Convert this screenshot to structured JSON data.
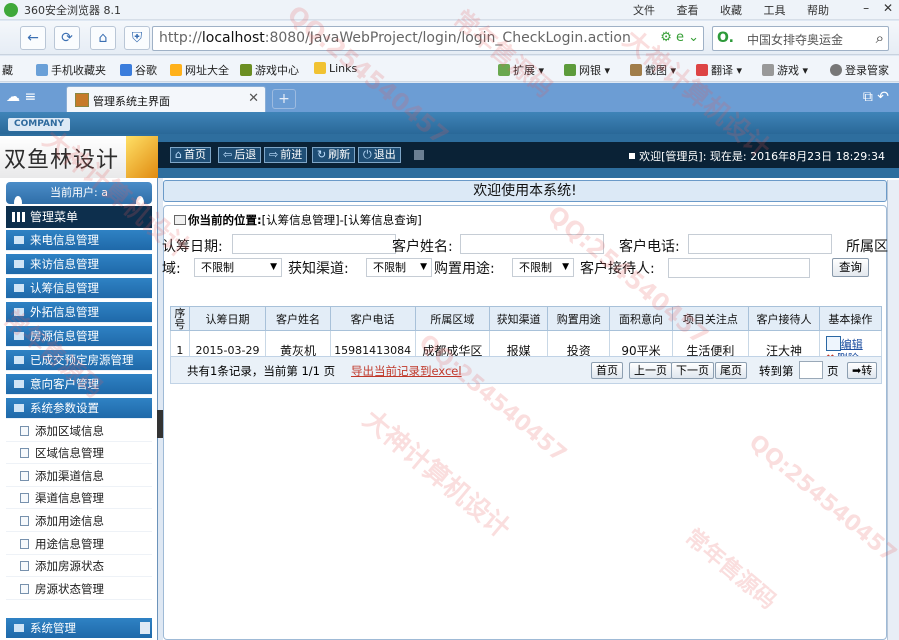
{
  "browser": {
    "title": "360安全浏览器 8.1",
    "menu": [
      "文件",
      "查看",
      "收藏",
      "工具",
      "帮助"
    ],
    "url_prefix": "http://",
    "url_host": "localhost",
    "url_rest": ":8080/JavaWebProject/login/login_CheckLogin.action",
    "search_text": "中国女排夺奥运金",
    "favorites": [
      "藏",
      "手机收藏夹",
      "谷歌",
      "网址大全",
      "游戏中心",
      "Links",
      "扩展",
      "网银",
      "截图",
      "翻译",
      "游戏",
      "登录管家"
    ],
    "tab_label": "管理系统主界面"
  },
  "header": {
    "company": "COMPANY",
    "logo_text": "双鱼林设计",
    "buttons": [
      "首页",
      "后退",
      "前进",
      "刷新",
      "退出"
    ],
    "welcome": "欢迎[管理员]:   现在是: 2016年8月23日 18:29:34"
  },
  "sidebar": {
    "current_user": "当前用户: a",
    "menu_title": "管理菜单",
    "items": [
      "来电信息管理",
      "来访信息管理",
      "认筹信息管理",
      "外拓信息管理",
      "房源信息管理",
      "已成交预定房源管理",
      "意向客户管理",
      "系统参数设置"
    ],
    "subitems": [
      "添加区域信息",
      "区域信息管理",
      "添加渠道信息",
      "渠道信息管理",
      "添加用途信息",
      "用途信息管理",
      "添加房源状态",
      "房源状态管理"
    ],
    "bottom": "系统管理"
  },
  "main": {
    "welcome": "欢迎使用本系统!",
    "location_label": "你当前的位置:",
    "location_path": "[认筹信息管理]-[认筹信息查询]"
  },
  "filter": {
    "date_label": "认筹日期:",
    "name_label": "客户姓名:",
    "phone_label": "客户电话:",
    "area_label_a": "所属区",
    "area_label_b": "域:",
    "area_value": "不限制",
    "channel_label": "获知渠道:",
    "channel_value": "不限制",
    "purpose_label": "购置用途:",
    "purpose_value": "不限制",
    "receptionist_label": "客户接待人:",
    "query_button": "查询"
  },
  "table": {
    "headers": [
      "序号",
      "认筹日期",
      "客户姓名",
      "客户电话",
      "所属区域",
      "获知渠道",
      "购置用途",
      "面积意向",
      "项目关注点",
      "客户接待人",
      "基本操作"
    ],
    "rows": [
      {
        "no": "1",
        "date": "2015-03-29",
        "name": "黄灰机",
        "phone": "15981413084",
        "area": "成都成华区",
        "channel": "报媒",
        "purpose": "投资",
        "size": "90平米",
        "focus": "生活便利",
        "receptionist": "汪大神",
        "edit": "编辑",
        "delete": "删除"
      }
    ]
  },
  "pager": {
    "summary": "共有1条记录，当前第 1/1 页",
    "export": "导出当前记录到excel",
    "first": "首页",
    "prev": "上一页",
    "next": "下一页",
    "last": "尾页",
    "goto_label": "转到第",
    "page_unit": "页",
    "go": "➡转"
  },
  "watermarks": [
    "QQ:254540457",
    "大神计算机设计",
    "常年售源码",
    "QQ:254540457",
    "大神计算机设计",
    "常年售源码",
    "QQ:254540457",
    "大神计算机设计",
    "QQ:254540457",
    "常年售源码"
  ],
  "colors": {
    "sidebar_item": "#2f82c4",
    "header_dark": "#0a2236",
    "accent_link": "#1e4fa0",
    "export_red": "#c0392b"
  }
}
